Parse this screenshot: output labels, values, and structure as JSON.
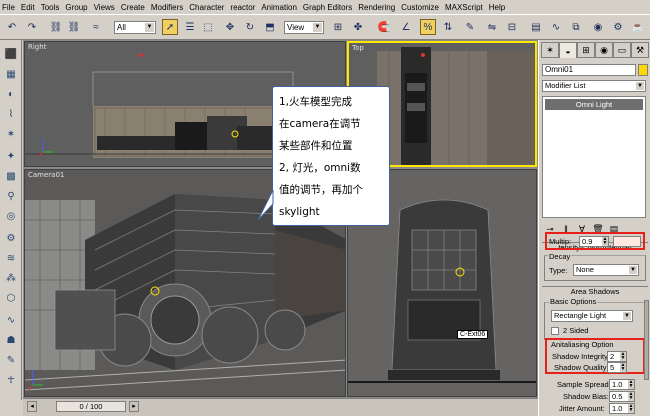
{
  "menu": [
    "File",
    "Edit",
    "Tools",
    "Group",
    "Views",
    "Create",
    "Modifiers",
    "Character",
    "reactor",
    "Animation",
    "Graph Editors",
    "Rendering",
    "Customize",
    "MAXScript",
    "Help"
  ],
  "toolbar": {
    "selection_filter": "All",
    "ref_coord": "View"
  },
  "viewports": {
    "right_label": "Right",
    "top_label": "Top",
    "camera_label": "Camera01",
    "camera_tag": "C-Ext06"
  },
  "callout": {
    "lines": [
      "1,火车模型完成",
      "在camera在调节",
      "某些部件和位置",
      "2, 灯光，omni数",
      "值的调节，再加个",
      "skylight"
    ]
  },
  "panel": {
    "object_name": "Omni01",
    "modifier_list": "Modifier List",
    "stack_item": "Omni Light",
    "intensity_title": "tensity/Color/Attenuati",
    "multiplier_label": "Multip:",
    "multiplier_value": "0.9",
    "decay_title": "Decay",
    "type_label": "Type:",
    "type_value": "None",
    "area_shadows_title": "Area Shadows",
    "basic_options_title": "Basic Options",
    "basic_options_value": "Rectangle Light",
    "two_sided_label": "2 Sided",
    "aa_title": "Anitaliasing Option",
    "shadow_integrity_label": "Shadow Integrity:",
    "shadow_integrity_value": "2",
    "shadow_quality_label": "Shadow Quality:",
    "shadow_quality_value": "5",
    "sample_spread_label": "Sample Spread:",
    "sample_spread_value": "1.0",
    "shadow_bias_label": "Shadow Bias:",
    "shadow_bias_value": "0.5",
    "jitter_label": "Jitter Amount:",
    "jitter_value": "1.0"
  },
  "timeline": {
    "frame": "0 / 100"
  },
  "colors": {
    "highlight": "#e8201a",
    "active_viewport": "#ffe600",
    "light_color": "#ffd800"
  }
}
